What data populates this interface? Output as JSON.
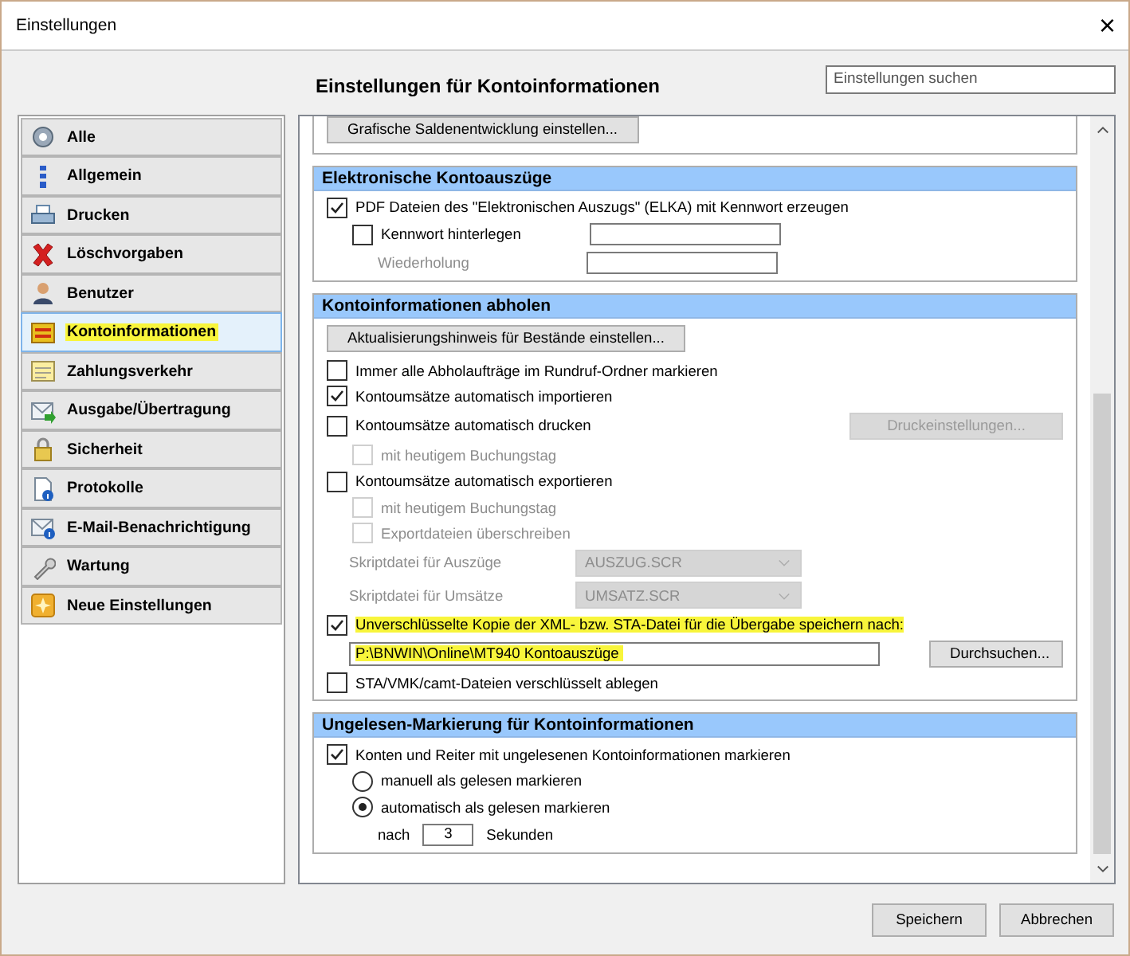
{
  "window": {
    "title": "Einstellungen",
    "close": "×"
  },
  "header": {
    "title": "Einstellungen für Kontoinformationen",
    "search": {
      "placeholder": "Einstellungen suchen"
    }
  },
  "sidebar": {
    "items": [
      {
        "label": "Alle",
        "selected": false,
        "highlighted": false
      },
      {
        "label": "Allgemein",
        "selected": false,
        "highlighted": false
      },
      {
        "label": "Drucken",
        "selected": false,
        "highlighted": false
      },
      {
        "label": "Löschvorgaben",
        "selected": false,
        "highlighted": false
      },
      {
        "label": "Benutzer",
        "selected": false,
        "highlighted": false
      },
      {
        "label": "Kontoinformationen",
        "selected": true,
        "highlighted": true
      },
      {
        "label": "Zahlungsverkehr",
        "selected": false,
        "highlighted": false
      },
      {
        "label": "Ausgabe/Übertragung",
        "selected": false,
        "highlighted": false
      },
      {
        "label": "Sicherheit",
        "selected": false,
        "highlighted": false
      },
      {
        "label": "Protokolle",
        "selected": false,
        "highlighted": false
      },
      {
        "label": "E-Mail-Benachrichtigung",
        "selected": false,
        "highlighted": false
      },
      {
        "label": "Wartung",
        "selected": false,
        "highlighted": false
      },
      {
        "label": "Neue Einstellungen",
        "selected": false,
        "highlighted": false
      }
    ]
  },
  "groups": [
    {
      "rows": [
        {
          "kind": "button",
          "label": "Grafische Saldenentwicklung einstellen..."
        }
      ]
    },
    {
      "title": "Elektronische Kontoauszüge",
      "rows": [
        {
          "kind": "checkbox",
          "label": "PDF Dateien des \"Elektronischen Auszugs\" (ELKA) mit Kennwort erzeugen",
          "checked": true,
          "disabled": false,
          "children": [
            {
              "kind": "checkbox_field",
              "label": "Kennwort hinterlegen",
              "checked": false,
              "disabled": false
            },
            {
              "kind": "label_field",
              "label": "Wiederholung",
              "disabled": true
            }
          ]
        }
      ]
    },
    {
      "title": "Kontoinformationen abholen",
      "rows": [
        {
          "kind": "button",
          "label": "Aktualisierungshinweis für Bestände einstellen..."
        },
        {
          "kind": "checkbox",
          "label": "Immer alle Abholaufträge im Rundruf-Ordner markieren",
          "checked": false,
          "disabled": false
        },
        {
          "kind": "checkbox",
          "label": "Kontoumsätze automatisch importieren",
          "checked": true,
          "disabled": false
        },
        {
          "kind": "checkbox",
          "label": "Kontoumsätze automatisch drucken",
          "checked": false,
          "disabled": false,
          "button": {
            "label": "Druckeinstellungen...",
            "disabled": true
          },
          "children": [
            {
              "kind": "checkbox",
              "label": "mit heutigem Buchungstag",
              "checked": false,
              "disabled": true
            }
          ]
        },
        {
          "kind": "checkbox",
          "label": "Kontoumsätze automatisch exportieren",
          "checked": false,
          "disabled": false,
          "children": [
            {
              "kind": "checkbox",
              "label": "mit heutigem Buchungstag",
              "checked": false,
              "disabled": true
            },
            {
              "kind": "checkbox",
              "label": "Exportdateien überschreiben",
              "checked": false,
              "disabled": true
            }
          ]
        },
        {
          "kind": "select",
          "label": "Skriptdatei für Auszüge",
          "value": "AUSZUG.SCR",
          "disabled": true
        },
        {
          "kind": "select",
          "label": "Skriptdatei für Umsätze",
          "value": "UMSATZ.SCR",
          "disabled": true
        },
        {
          "kind": "checkbox",
          "label": "Unverschlüsselte Kopie der XML- bzw. STA-Datei für die Übergabe speichern nach:",
          "checked": true,
          "disabled": false,
          "highlighted": true
        },
        {
          "kind": "path_field",
          "value": "P:\\BNWIN\\Online\\MT940 Kontoauszüge",
          "button": "Durchsuchen...",
          "highlighted": true
        },
        {
          "kind": "checkbox",
          "label": "STA/VMK/camt-Dateien verschlüsselt ablegen",
          "checked": false,
          "disabled": false
        }
      ]
    },
    {
      "title": "Ungelesen-Markierung für Kontoinformationen",
      "rows": [
        {
          "kind": "checkbox",
          "label": "Konten und Reiter mit ungelesenen Kontoinformationen markieren",
          "checked": true,
          "disabled": false,
          "children": [
            {
              "kind": "radio",
              "label": "manuell als gelesen markieren",
              "selected": false
            },
            {
              "kind": "radio",
              "label": "automatisch als gelesen markieren",
              "selected": true,
              "children": [
                {
                  "kind": "number_field",
                  "label": "nach",
                  "value": "3",
                  "unit": "Sekunden"
                }
              ]
            }
          ]
        }
      ]
    }
  ],
  "footer": {
    "buttons": [
      "Speichern",
      "Abbrechen"
    ]
  }
}
